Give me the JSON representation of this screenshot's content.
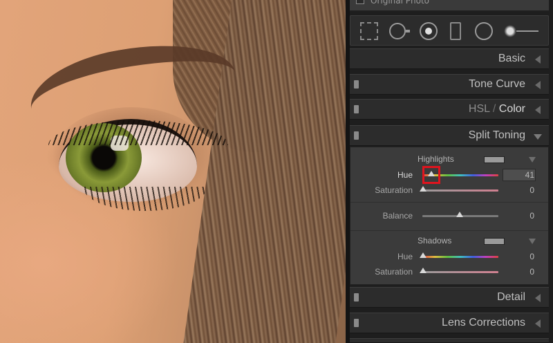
{
  "top": {
    "original_photo_label": "Original Photo"
  },
  "tools": [
    {
      "name": "crop-overlay-icon"
    },
    {
      "name": "spot-removal-icon"
    },
    {
      "name": "red-eye-icon"
    },
    {
      "name": "graduated-filter-icon"
    },
    {
      "name": "radial-filter-icon"
    },
    {
      "name": "adjustment-brush-icon"
    }
  ],
  "panels": {
    "basic": "Basic",
    "tone_curve": "Tone Curve",
    "hsl": {
      "hsl": "HSL",
      "sep": " / ",
      "color": "Color"
    },
    "split_toning": "Split Toning",
    "detail": "Detail",
    "lens_corrections": "Lens Corrections"
  },
  "split_toning": {
    "highlights": {
      "title": "Highlights",
      "swatch_color": "#9a9a9a",
      "hue_label": "Hue",
      "hue_value": "41",
      "saturation_label": "Saturation",
      "saturation_value": "0"
    },
    "balance": {
      "label": "Balance",
      "value": "0"
    },
    "shadows": {
      "title": "Shadows",
      "swatch_color": "#9a9a9a",
      "hue_label": "Hue",
      "hue_value": "0",
      "saturation_label": "Saturation",
      "saturation_value": "0"
    }
  },
  "colors": {
    "highlight_marker": "#e0141e",
    "panel_bg": "#3b3b3b"
  }
}
